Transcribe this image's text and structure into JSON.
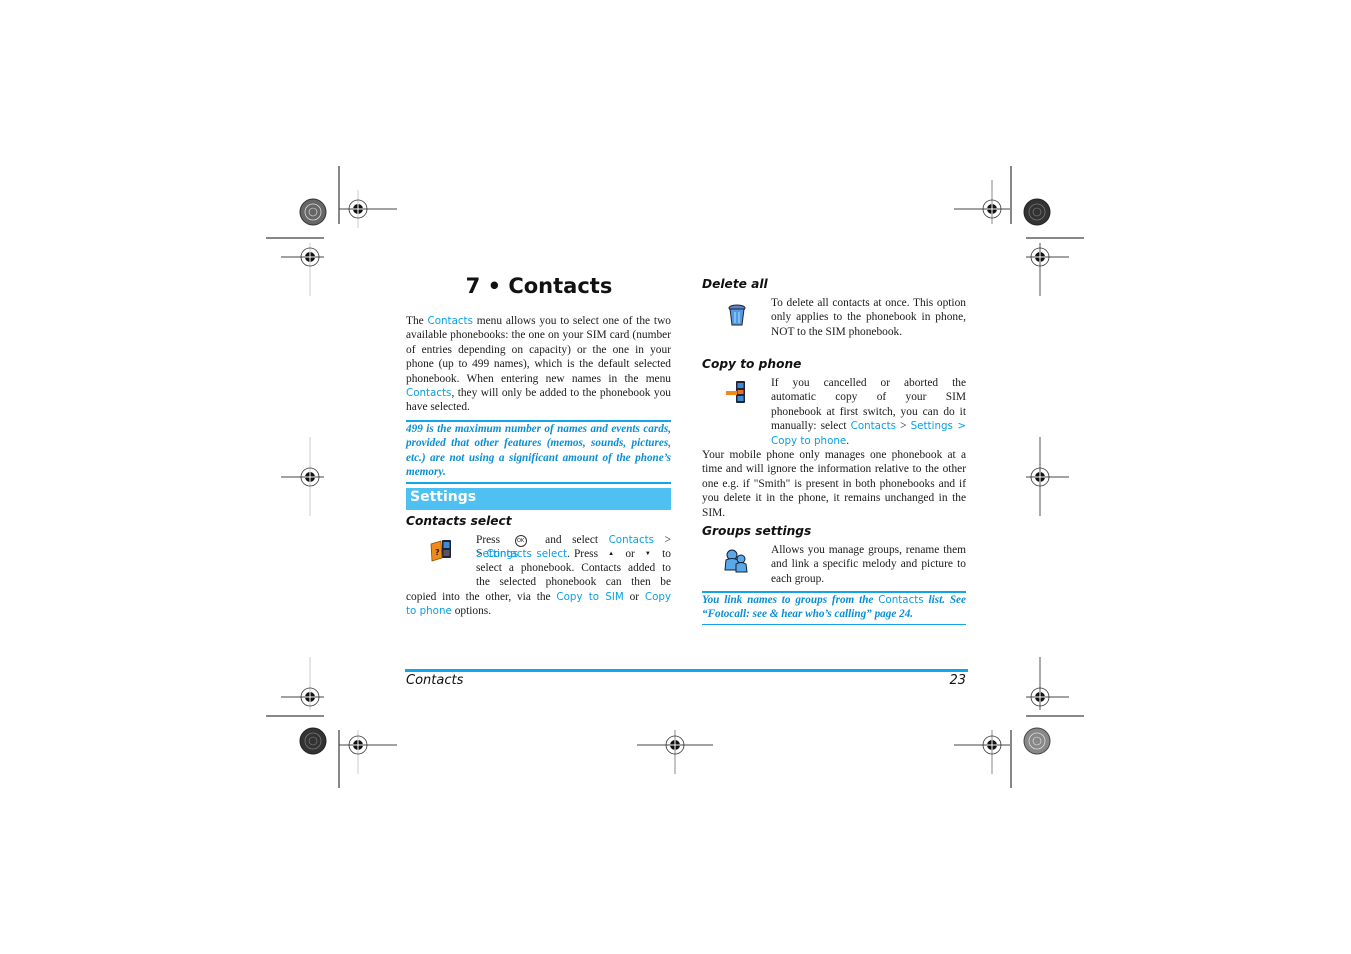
{
  "page": {
    "chapter_title": "7 • Contacts",
    "intro": {
      "t1": "The ",
      "link1": "Contacts",
      "t2": " menu allows you to select one of the two available phonebooks: the one on your SIM card (number of entries depending on capacity) or the one in your phone (up to 499 names), which is the default selected phonebook. When entering new names in the menu ",
      "link2": "Contacts",
      "t3": ", they will only be added to the phonebook you have selected."
    },
    "note1": "499 is the maximum number of names and events cards, provided that other features (memos, sounds, pictures, etc.) are not using a significant amount of the phone’s memory.",
    "section_title": "Settings",
    "contacts_select": {
      "heading": "Contacts select",
      "icon": "phonebook-icon",
      "t1": "Press ",
      "ok_key": "OK",
      "t2": " and select ",
      "link_contacts": "Contacts",
      "sep1": " > ",
      "link_settings": "Settings",
      "sep2": "> ",
      "link_select": "Contacts select",
      "t3": ". Press ",
      "up_key": "▲",
      "t4": " or ",
      "down_key": "▼",
      "t5": " to select a phonebook. Contacts added to the selected phonebook can then be copied into the other, via the ",
      "link_copy_sim": "Copy to SIM",
      "t6": " or ",
      "link_copy_phone": "Copy to phone",
      "t7": " options."
    },
    "delete_all": {
      "heading": "Delete all",
      "icon": "trash-icon",
      "body": "To delete all contacts at once. This option only applies to the phonebook in phone, NOT to the SIM phonebook."
    },
    "copy_to_phone": {
      "heading": "Copy to phone",
      "icon": "copy-to-phone-icon",
      "t1": "If you cancelled or aborted the automatic copy of your SIM phonebook at first switch, you can do it manually: select ",
      "link_contacts": "Contacts",
      "sep1": " > ",
      "link_settings": "Settings >",
      "link_copy": "Copy to phone",
      "t2": ".",
      "para2": "Your mobile phone only manages one phonebook at a time and will ignore the information relative to the other one e.g. if \"Smith\" is present in both phonebooks and if you delete it in the phone, it remains unchanged in the SIM."
    },
    "groups_settings": {
      "heading": "Groups settings",
      "icon": "groups-icon",
      "body": "Allows you manage groups, rename them and link a specific melody and picture to each group."
    },
    "note2": {
      "t1": "You link names to groups from the ",
      "link": "Contacts",
      "t2": " list. See “Fotocall: see & hear who’s calling” page 24."
    },
    "footer": {
      "section": "Contacts",
      "page_number": "23"
    }
  },
  "colors": {
    "accent": "#0aa0e6",
    "section_bar": "#4fc0f2",
    "rule": "#11a6ea"
  }
}
